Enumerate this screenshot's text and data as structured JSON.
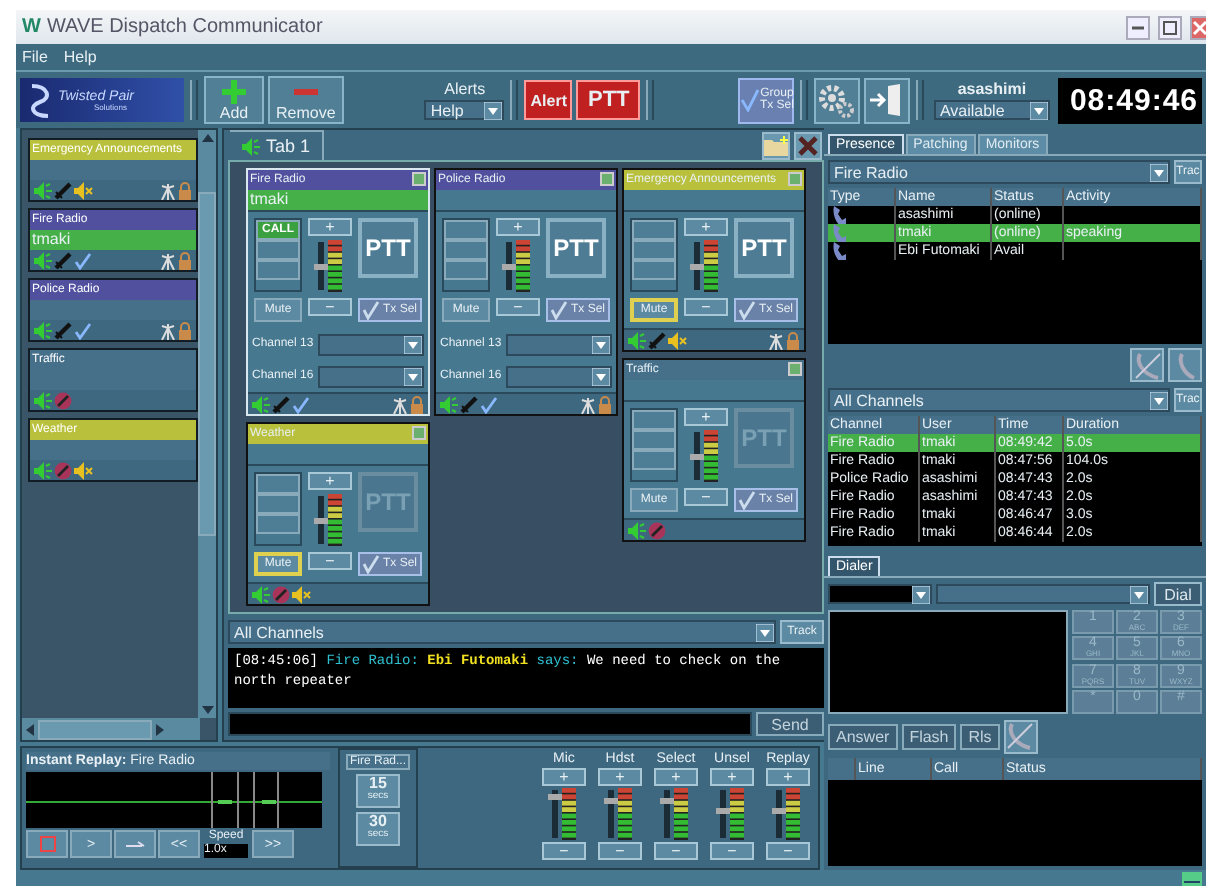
{
  "window": {
    "app_icon": "W",
    "title": "WAVE Dispatch Communicator"
  },
  "menu": [
    {
      "label": "File"
    },
    {
      "label": "Help"
    }
  ],
  "toolbar": {
    "logo": [
      "Twisted Pair",
      "Solutions"
    ],
    "add": "Add",
    "remove": "Remove",
    "alerts_label": "Alerts",
    "alerts_value": "Help",
    "alert": "Alert",
    "ptt": "PTT",
    "group_tx": [
      "Group",
      "Tx Sel"
    ],
    "user": "asashimi",
    "availability": "Available",
    "clock": "08:49:46"
  },
  "sidebar": {
    "items": [
      {
        "name": "Emergency Announcements",
        "color": "#b9c03c",
        "speaking": false,
        "muted": true,
        "tx_selected": false,
        "ptt_enabled": true
      },
      {
        "name": "Fire Radio",
        "color": "#50509e",
        "user": "tmaki",
        "speaking": true,
        "muted": false,
        "tx_selected": true,
        "ptt_enabled": true
      },
      {
        "name": "Police Radio",
        "color": "#50509e",
        "speaking": false,
        "muted": false,
        "tx_selected": true,
        "ptt_enabled": true
      },
      {
        "name": "Traffic",
        "color": "#46708a",
        "speaking": false,
        "muted": false,
        "tx_selected": false,
        "ptt_enabled": false
      },
      {
        "name": "Weather",
        "color": "#b9c03c",
        "speaking": false,
        "muted": true,
        "tx_selected": false,
        "ptt_enabled": false
      }
    ]
  },
  "tab": {
    "label": "Tab 1",
    "columns": [
      {
        "cards": [
          {
            "name": "Fire Radio",
            "color": "#50509e",
            "user": "tmaki",
            "speaking": true,
            "selected": true,
            "call": "CALL",
            "muted": false,
            "tx_selected": true,
            "ptt_enabled": true,
            "level": 0.45,
            "labels": {
              "ptt": "PTT",
              "mute": "Mute",
              "tx": "Tx Sel",
              "up": "+",
              "down": "−"
            },
            "channels": [
              "Channel 13",
              "Channel 16"
            ]
          },
          {
            "name": "Weather",
            "color": "#b9c03c",
            "speaking": false,
            "selected": false,
            "muted": true,
            "tx_selected": true,
            "ptt_enabled": false,
            "level": 0.45,
            "labels": {
              "ptt": "PTT",
              "mute": "Mute",
              "tx": "Tx Sel",
              "up": "+",
              "down": "−"
            }
          }
        ]
      },
      {
        "cards": [
          {
            "name": "Police Radio",
            "color": "#50509e",
            "speaking": false,
            "selected": false,
            "muted": false,
            "tx_selected": true,
            "ptt_enabled": true,
            "level": 0.45,
            "labels": {
              "ptt": "PTT",
              "mute": "Mute",
              "tx": "Tx Sel",
              "up": "+",
              "down": "−"
            },
            "channels": [
              "Channel 13",
              "Channel 16"
            ]
          }
        ]
      },
      {
        "cards": [
          {
            "name": "Emergency Announcements",
            "color": "#b9c03c",
            "speaking": false,
            "selected": false,
            "muted": true,
            "tx_selected": true,
            "ptt_enabled": true,
            "level": 0.45,
            "labels": {
              "ptt": "PTT",
              "mute": "Mute",
              "tx": "Tx Sel",
              "up": "+",
              "down": "−"
            }
          },
          {
            "name": "Traffic",
            "color": "#46708a",
            "speaking": false,
            "selected": false,
            "muted": false,
            "tx_selected": true,
            "ptt_enabled": false,
            "level": 0.45,
            "labels": {
              "ptt": "PTT",
              "mute": "Mute",
              "tx": "Tx Sel",
              "up": "+",
              "down": "−"
            }
          }
        ]
      }
    ]
  },
  "chat": {
    "filter": "All Channels",
    "track": "Track",
    "messages": [
      {
        "time": "[08:45:06]",
        "channel": "Fire Radio:",
        "user": "Ebi Futomaki",
        "verb": "says:",
        "text": "We need to check on the north repeater"
      }
    ],
    "send": {
      "label": "Send",
      "disabled": true
    }
  },
  "replay": {
    "label": "Instant Replay:",
    "channel": "Fire Radio",
    "play": ">",
    "rewind": "<<",
    "speed_label": "Speed",
    "speed": "1.0x",
    "forward": ">>",
    "source": "Fire Rad...",
    "jumps": [
      {
        "value": "15",
        "unit": "secs"
      },
      {
        "value": "30",
        "unit": "secs"
      }
    ]
  },
  "volumes": [
    {
      "label": "Mic",
      "level": 0.85,
      "up": "+",
      "down": "−"
    },
    {
      "label": "Hdst",
      "level": 0.75,
      "up": "+",
      "down": "−"
    },
    {
      "label": "Select",
      "level": 0.75,
      "up": "+",
      "down": "−"
    },
    {
      "label": "Unsel",
      "level": 0.55,
      "up": "+",
      "down": "−"
    },
    {
      "label": "Replay",
      "level": 0.55,
      "up": "+",
      "down": "−"
    }
  ],
  "presence": {
    "tabs": [
      {
        "label": "Presence",
        "selected": true
      },
      {
        "label": "Patching",
        "selected": false
      },
      {
        "label": "Monitors",
        "selected": false
      }
    ],
    "group": "Fire Radio",
    "track": "Trac",
    "columns": [
      "Type",
      "Name",
      "Status",
      "Activity"
    ],
    "rows": [
      {
        "name": "asashimi",
        "status": "(online)",
        "selected": false
      },
      {
        "name": "tmaki",
        "status": "(online)",
        "activity": "speaking",
        "selected": true
      },
      {
        "name": "Ebi Futomaki",
        "status": "Avail",
        "selected": false
      }
    ]
  },
  "activity": {
    "filter": "All Channels",
    "track": "Trac",
    "columns": [
      "Channel",
      "User",
      "Time",
      "Duration"
    ],
    "rows": [
      {
        "channel": "Fire Radio",
        "user": "tmaki",
        "time": "08:49:42",
        "duration": "5.0s",
        "selected": true
      },
      {
        "channel": "Fire Radio",
        "user": "tmaki",
        "time": "08:47:56",
        "duration": "104.0s",
        "selected": false
      },
      {
        "channel": "Police Radio",
        "user": "asashimi",
        "time": "08:47:43",
        "duration": "2.0s",
        "selected": false
      },
      {
        "channel": "Fire Radio",
        "user": "asashimi",
        "time": "08:47:43",
        "duration": "2.0s",
        "selected": false
      },
      {
        "channel": "Fire Radio",
        "user": "tmaki",
        "time": "08:46:47",
        "duration": "3.0s",
        "selected": false
      },
      {
        "channel": "Fire Radio",
        "user": "tmaki",
        "time": "08:46:44",
        "duration": "2.0s",
        "selected": false
      }
    ]
  },
  "dialer": {
    "tab": "Dialer",
    "dial": "Dial",
    "keys": [
      {
        "digit": "1"
      },
      {
        "digit": "2",
        "letters": "ABC"
      },
      {
        "digit": "3",
        "letters": "DEF"
      },
      {
        "digit": "4",
        "letters": "GHI"
      },
      {
        "digit": "5",
        "letters": "JKL"
      },
      {
        "digit": "6",
        "letters": "MNO"
      },
      {
        "digit": "7",
        "letters": "PQRS"
      },
      {
        "digit": "8",
        "letters": "TUV"
      },
      {
        "digit": "9",
        "letters": "WXYZ"
      },
      {
        "digit": "*"
      },
      {
        "digit": "0"
      },
      {
        "digit": "#"
      }
    ],
    "buttons": [
      {
        "label": "Answer",
        "disabled": true
      },
      {
        "label": "Flash",
        "disabled": true
      },
      {
        "label": "Rls",
        "disabled": true
      }
    ],
    "columns": [
      "Line",
      "Call",
      "Status"
    ]
  }
}
